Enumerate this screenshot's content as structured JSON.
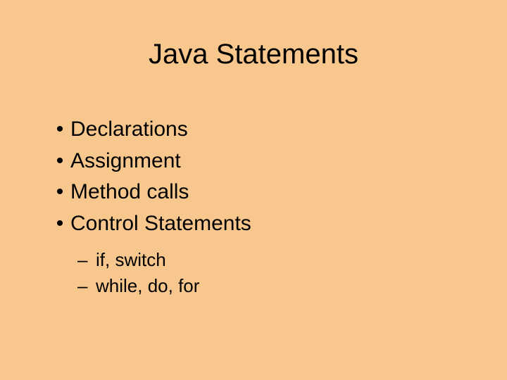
{
  "slide": {
    "title": "Java Statements",
    "bullets": {
      "b1": "Declarations",
      "b2": "Assignment",
      "b3": "Method calls",
      "b4": "Control Statements"
    },
    "subbullets": {
      "s1": "if, switch",
      "s2": "while, do, for"
    },
    "bullet_glyph": "•",
    "dash_glyph": "–"
  }
}
